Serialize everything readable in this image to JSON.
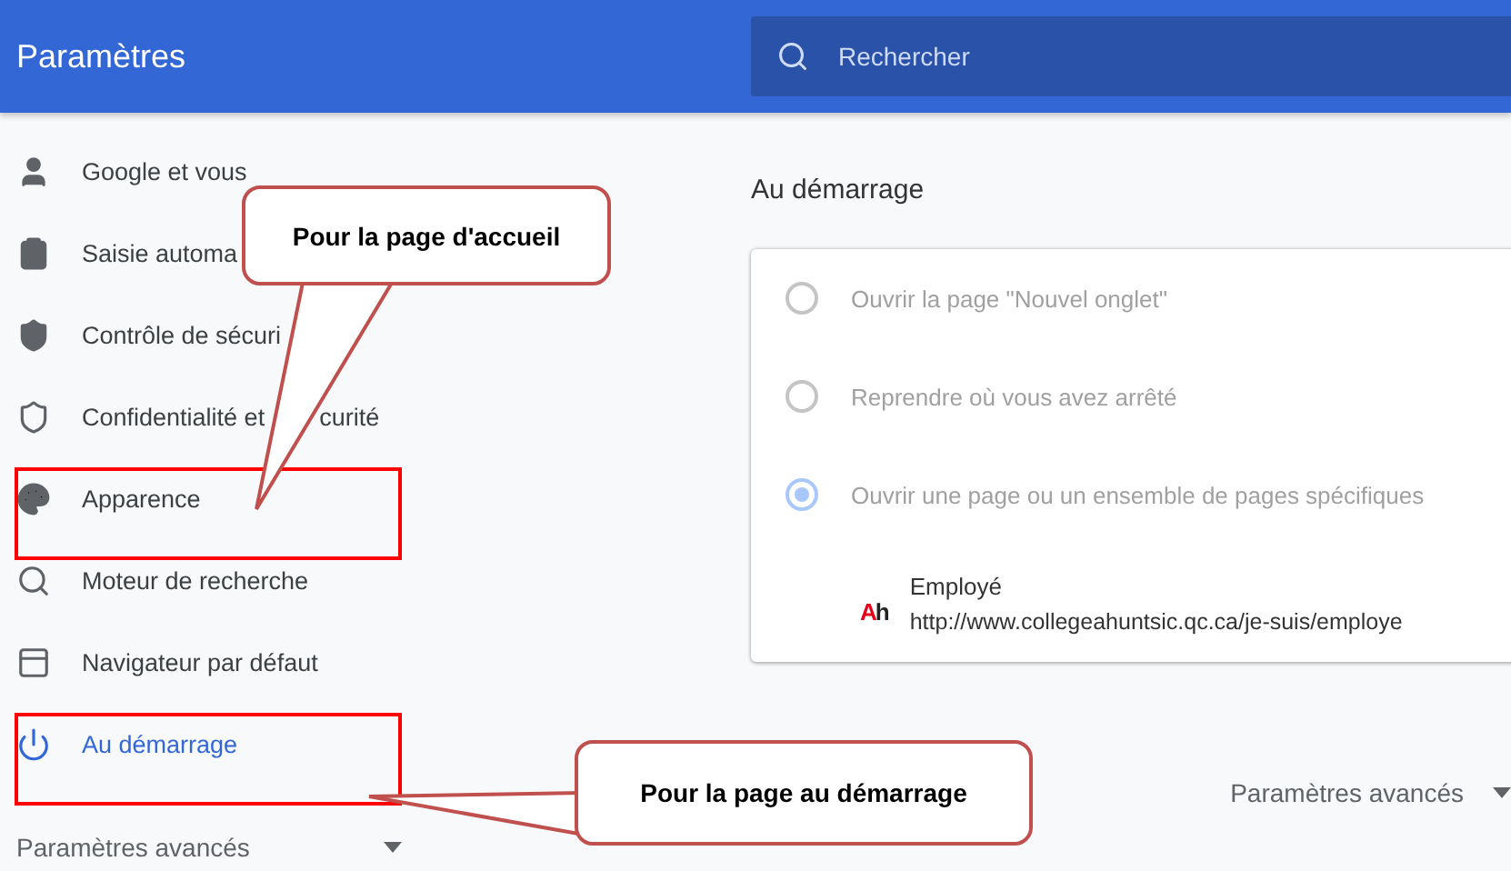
{
  "window": {
    "title": "Paramètres"
  },
  "search": {
    "placeholder": "Rechercher"
  },
  "sidebar": {
    "items": [
      {
        "label": "Google et vous",
        "selected": false,
        "highlighted": false
      },
      {
        "label": "Saisie automa",
        "selected": false,
        "highlighted": false
      },
      {
        "label": "Contrôle de sécuri",
        "selected": false,
        "highlighted": false
      },
      {
        "label": "Confidentialité et",
        "label_end": "curité",
        "selected": false,
        "highlighted": false
      },
      {
        "label": "Apparence",
        "selected": false,
        "highlighted": true
      },
      {
        "label": "Moteur de recherche",
        "selected": false,
        "highlighted": false
      },
      {
        "label": "Navigateur par défaut",
        "selected": false,
        "highlighted": false
      },
      {
        "label": "Au démarrage",
        "selected": true,
        "highlighted": true
      }
    ],
    "advanced": {
      "label": "Paramètres avancés"
    }
  },
  "startup": {
    "heading": "Au démarrage",
    "options": [
      {
        "label": "Ouvrir la page \"Nouvel onglet\"",
        "selected": false,
        "disabled": true
      },
      {
        "label": "Reprendre où vous avez arrêté",
        "selected": false,
        "disabled": true
      },
      {
        "label": "Ouvrir une page ou un ensemble de pages spécifiques",
        "selected": true,
        "disabled": true
      }
    ],
    "pages": [
      {
        "favicon": "Ah",
        "title": "Employé",
        "url": "http://www.collegeahuntsic.qc.ca/je-suis/employe"
      }
    ]
  },
  "advanced_toggle": {
    "label": "Paramètres avancés"
  },
  "callouts": [
    {
      "text": "Pour la page d'accueil"
    },
    {
      "text": "Pour la page au démarrage"
    }
  ]
}
